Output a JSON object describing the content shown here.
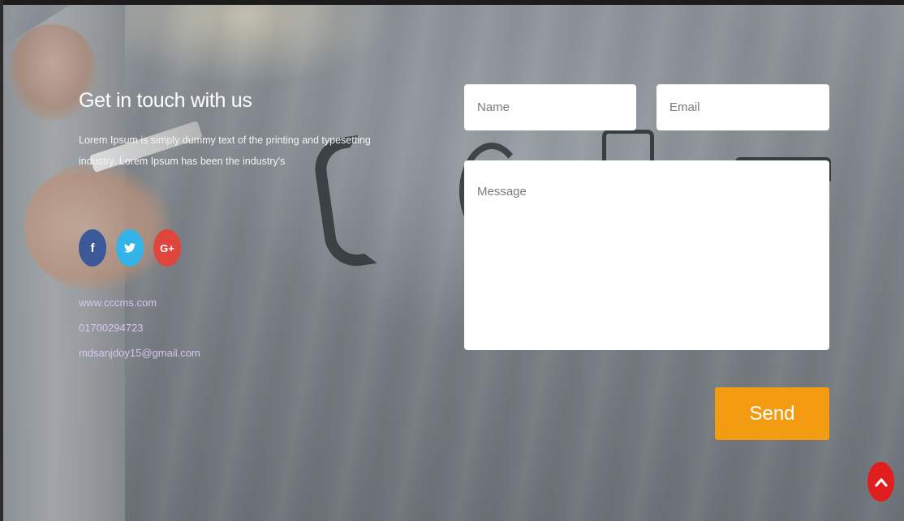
{
  "contact": {
    "heading": "Get in touch with us",
    "description": "Lorem Ipsum is simply dummy text of the printing and typesetting industry. Lorem Ipsum has been the industry's",
    "website": "www.cccms.com",
    "phone": "01700294723",
    "email": "mdsanjdoy15@gmail.com"
  },
  "social": {
    "facebook_glyph": "f",
    "google_glyph": "G+",
    "icons": [
      "facebook-icon",
      "twitter-icon",
      "google-plus-icon"
    ],
    "colors": {
      "facebook": "#3b5998",
      "twitter": "#33b4e8",
      "google_plus": "#e0453c"
    }
  },
  "form": {
    "name_placeholder": "Name",
    "email_placeholder": "Email",
    "message_placeholder": "Message",
    "send_label": "Send"
  },
  "theme": {
    "accent": "#f39c12",
    "scroll_top_color": "#e01e1e",
    "link_color": "#d6c6f2"
  }
}
